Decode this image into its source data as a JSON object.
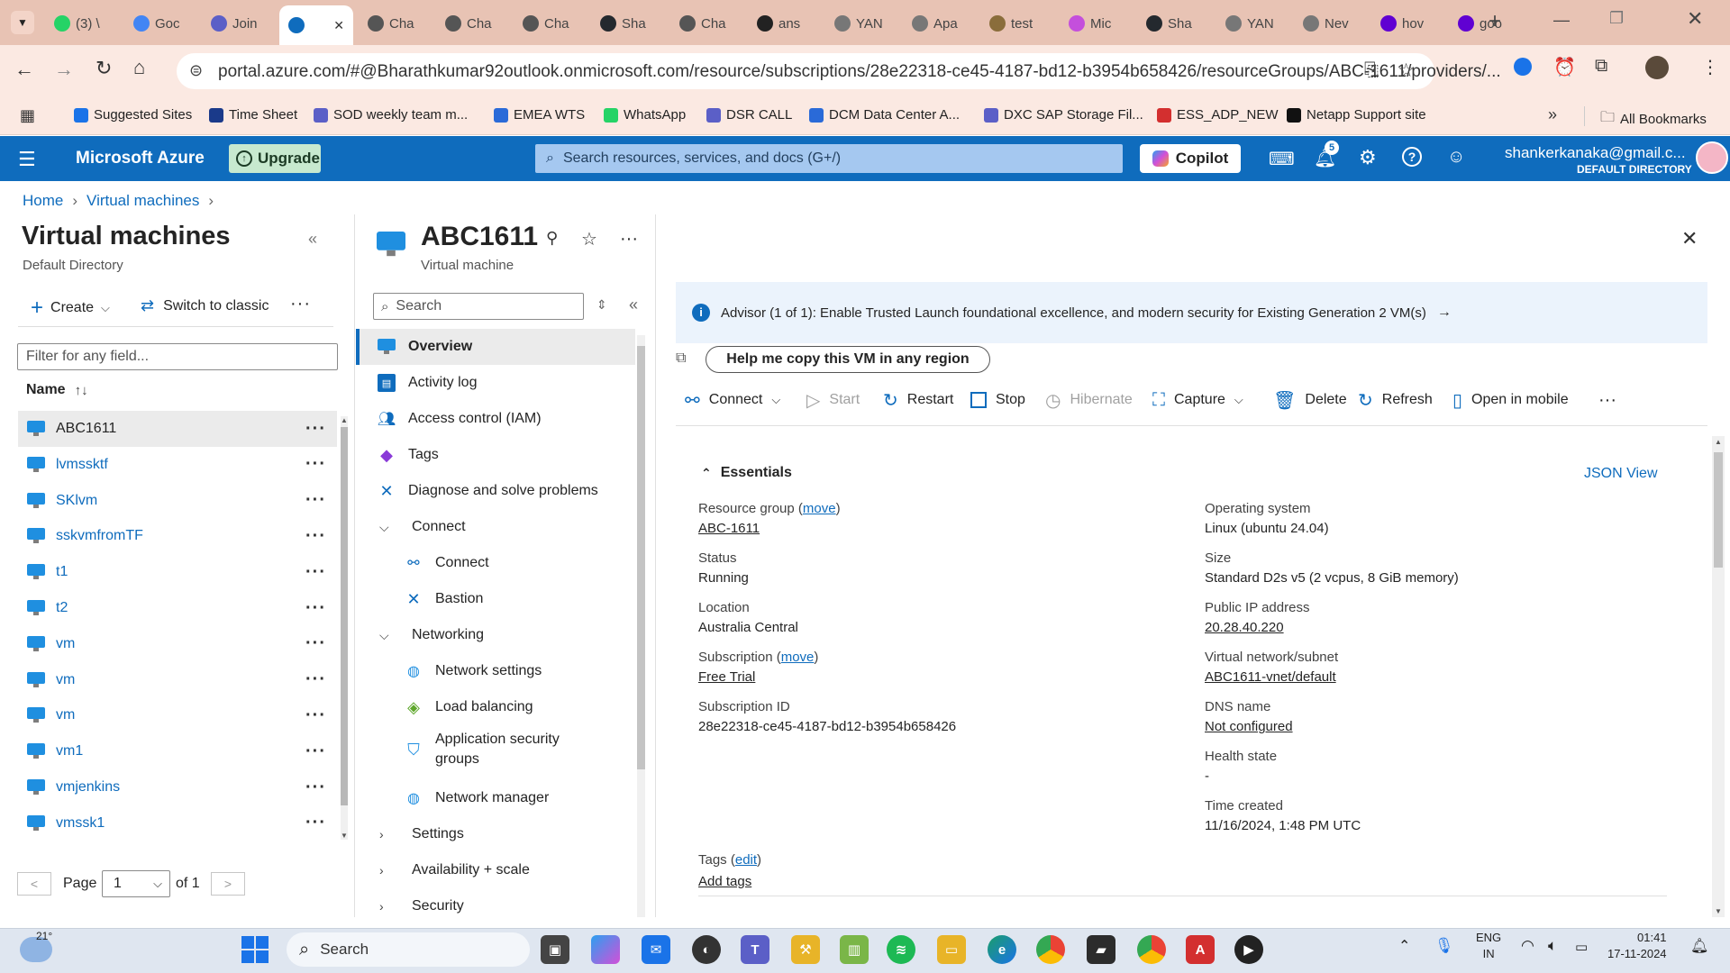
{
  "browser": {
    "tabs": [
      {
        "label": "(3) \\",
        "color": "#25d366"
      },
      {
        "label": "Goc",
        "color": "#4285f4"
      },
      {
        "label": "Join",
        "color": "#5b5fc7"
      },
      {
        "label": "",
        "color": "#0f6cbd"
      },
      {
        "label": "Cha",
        "color": "#555555"
      },
      {
        "label": "Cha",
        "color": "#555555"
      },
      {
        "label": "Cha",
        "color": "#555555"
      },
      {
        "label": "Sha",
        "color": "#24292e"
      },
      {
        "label": "Cha",
        "color": "#555555"
      },
      {
        "label": "ans",
        "color": "#222222"
      },
      {
        "label": "YAN",
        "color": "#777777"
      },
      {
        "label": "Apa",
        "color": "#777777"
      },
      {
        "label": "test",
        "color": "#8a6d3b"
      },
      {
        "label": "Mic",
        "color": "#c44fdc"
      },
      {
        "label": "Sha",
        "color": "#24292e"
      },
      {
        "label": "YAN",
        "color": "#777777"
      },
      {
        "label": "Nev",
        "color": "#777777"
      },
      {
        "label": "hov",
        "color": "#6001d2"
      },
      {
        "label": "goo",
        "color": "#6001d2"
      }
    ],
    "url": "portal.azure.com/#@Bharathkumar92outlook.onmicrosoft.com/resource/subscriptions/28e22318-ce45-4187-bd12-b3954b658426/resourceGroups/ABC-1611/providers/...",
    "bookmarks": [
      {
        "label": "Suggested Sites",
        "color": "#1a73e8"
      },
      {
        "label": "Time Sheet",
        "color": "#1a3a8a"
      },
      {
        "label": "SOD weekly team m...",
        "color": "#5b5fc7"
      },
      {
        "label": "EMEA WTS",
        "color": "#2a6ad8"
      },
      {
        "label": "WhatsApp",
        "color": "#25d366"
      },
      {
        "label": "DSR CALL",
        "color": "#5b5fc7"
      },
      {
        "label": "DCM Data Center A...",
        "color": "#2a6ad8"
      },
      {
        "label": "DXC SAP Storage Fil...",
        "color": "#5b5fc7"
      },
      {
        "label": "ESS_ADP_NEW",
        "color": "#d32f2f"
      },
      {
        "label": "Netapp Support site",
        "color": "#111111"
      }
    ],
    "all_bookmarks": "All Bookmarks"
  },
  "azure": {
    "brand": "Microsoft Azure",
    "upgrade": "Upgrade",
    "search_placeholder": "Search resources, services, and docs (G+/)",
    "copilot": "Copilot",
    "notif_count": "5",
    "user_email": "shankerkanaka@gmail.c...",
    "user_dir": "DEFAULT DIRECTORY"
  },
  "breadcrumb": [
    "Home",
    "Virtual machines"
  ],
  "vmlist": {
    "title": "Virtual machines",
    "subtitle": "Default Directory",
    "create": "Create",
    "switch": "Switch to classic",
    "filter_placeholder": "Filter for any field...",
    "name_header": "Name",
    "items": [
      "ABC1611",
      "lvmssktf",
      "SKlvm",
      "sskvmfromTF",
      "t1",
      "t2",
      "vm",
      "vm",
      "vm",
      "vm1",
      "vmjenkins",
      "vmssk1"
    ],
    "page_label": "Page",
    "page_value": "1",
    "of_label": "of 1"
  },
  "resource": {
    "name": "ABC1611",
    "type": "Virtual machine",
    "search_placeholder": "Search"
  },
  "menu": {
    "overview": "Overview",
    "activity_log": "Activity log",
    "iam": "Access control (IAM)",
    "tags": "Tags",
    "diagnose": "Diagnose and solve problems",
    "connect_group": "Connect",
    "connect": "Connect",
    "bastion": "Bastion",
    "networking_group": "Networking",
    "network_settings": "Network settings",
    "load_balancing": "Load balancing",
    "asg_line1": "Application security",
    "asg_line2": "groups",
    "network_manager": "Network manager",
    "settings": "Settings",
    "availability": "Availability + scale",
    "security": "Security"
  },
  "advisor": "Advisor (1 of 1): Enable Trusted Launch foundational excellence, and modern security for Existing Generation 2 VM(s)",
  "copy_vm": "Help me copy this VM in any region",
  "commands": {
    "connect": "Connect",
    "start": "Start",
    "restart": "Restart",
    "stop": "Stop",
    "hibernate": "Hibernate",
    "capture": "Capture",
    "delete": "Delete",
    "refresh": "Refresh",
    "open_mobile": "Open in mobile"
  },
  "essentials": {
    "title": "Essentials",
    "json_view": "JSON View",
    "move": "move",
    "rg_label": "Resource group",
    "rg_value": "ABC-1611",
    "status_label": "Status",
    "status_value": "Running",
    "location_label": "Location",
    "location_value": "Australia Central",
    "sub_label": "Subscription",
    "sub_value": "Free Trial",
    "subid_label": "Subscription ID",
    "subid_value": "28e22318-ce45-4187-bd12-b3954b658426",
    "os_label": "Operating system",
    "os_value": "Linux (ubuntu 24.04)",
    "size_label": "Size",
    "size_value": "Standard D2s v5 (2 vcpus, 8 GiB memory)",
    "ip_label": "Public IP address",
    "ip_value": "20.28.40.220",
    "vnet_label": "Virtual network/subnet",
    "vnet_value": "ABC1611-vnet/default",
    "dns_label": "DNS name",
    "dns_value": "Not configured",
    "health_label": "Health state",
    "health_value": "-",
    "time_label": "Time created",
    "time_value": "11/16/2024, 1:48 PM UTC",
    "tags_label": "Tags",
    "tags_edit": "edit",
    "add_tags": "Add tags"
  },
  "taskbar": {
    "temp": "21°",
    "search": "Search",
    "lang1": "ENG",
    "lang2": "IN",
    "time": "01:41",
    "date": "17-11-2024"
  }
}
